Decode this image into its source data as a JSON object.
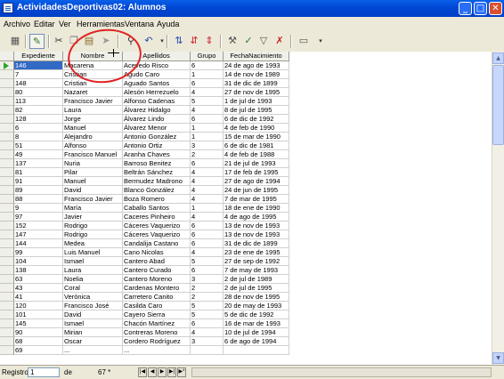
{
  "window": {
    "title": "ActividadesDeportivas02: Alumnos",
    "min": "_",
    "max": "□",
    "close": "✕"
  },
  "menu": [
    "Archivo",
    "Editar",
    "Ver",
    "Herramientas",
    "Ventana",
    "Ayuda"
  ],
  "toolbar": {
    "icons": [
      "save-icon",
      "edit-icon",
      "cut-icon",
      "copy-icon",
      "paste-icon",
      "forward-icon",
      "binoculars-icon",
      "undo-icon",
      "sort-az-icon",
      "sort-za-icon",
      "sort-icon",
      "autofilter-icon",
      "filter-apply-icon",
      "funnel-icon",
      "remove-filter-icon",
      "datasource-icon"
    ]
  },
  "grid": {
    "columns": [
      "Expediente",
      "Nombre",
      "Apellidos",
      "Grupo",
      "FechaNacimiento"
    ],
    "rows": [
      [
        "146",
        "Macarena",
        "Acevedo Risco",
        "6",
        "24 de ago de 1993"
      ],
      [
        "7",
        "Cristian",
        "Agudo Caro",
        "1",
        "14 de nov de 1989"
      ],
      [
        "148",
        "Cristian",
        "Aguado Santos",
        "6",
        "31 de dic de 1899"
      ],
      [
        "80",
        "Nazaret",
        "Alesón Herrezuelo",
        "4",
        "27 de nov de 1995"
      ],
      [
        "113",
        "Francisco Javier",
        "Alfonso Cadenas",
        "5",
        "1 de jul de 1993"
      ],
      [
        "82",
        "Laura",
        "Álvarez Hidalgo",
        "4",
        "8 de jul de 1995"
      ],
      [
        "128",
        "Jorge",
        "Álvarez Lindo",
        "6",
        "6 de dic de 1992"
      ],
      [
        "6",
        "Manuel",
        "Álvarez Menor",
        "1",
        "4 de feb de 1990"
      ],
      [
        "8",
        "Alejandro",
        "Antonio González",
        "1",
        "15 de mar de 1990"
      ],
      [
        "51",
        "Alfonso",
        "Antonio Ortiz",
        "3",
        "6 de dic de 1981"
      ],
      [
        "49",
        "Francisco Manuel",
        "Aranha Chaves",
        "2",
        "4 de feb de 1988"
      ],
      [
        "137",
        "Nuria",
        "Barroso Benitez",
        "6",
        "21 de jul de 1993"
      ],
      [
        "81",
        "Pilar",
        "Beltrán Sánchez",
        "4",
        "17 de feb de 1995"
      ],
      [
        "91",
        "Manuel",
        "Bermudez Madrono",
        "4",
        "27 de ago de 1994"
      ],
      [
        "89",
        "David",
        "Blanco González",
        "4",
        "24 de jun de 1995"
      ],
      [
        "88",
        "Francisco Javier",
        "Boza Romero",
        "4",
        "7 de mar de 1995"
      ],
      [
        "9",
        "María",
        "Caballo Santos",
        "1",
        "18 de ene de 1990"
      ],
      [
        "97",
        "Javier",
        "Caceres Pinheiro",
        "4",
        "4 de ago de 1995"
      ],
      [
        "152",
        "Rodrigo",
        "Cáceres Vaquerizo",
        "6",
        "13 de nov de 1993"
      ],
      [
        "147",
        "Rodrigo",
        "Cáceres Vaquerizo",
        "6",
        "13 de nov de 1993"
      ],
      [
        "144",
        "Medea",
        "Candalija Castano",
        "6",
        "31 de dic de 1899"
      ],
      [
        "99",
        "Luis Manuel",
        "Cano Nicolas",
        "4",
        "23 de ene de 1995"
      ],
      [
        "104",
        "Ismael",
        "Cantero Abad",
        "5",
        "27 de sep de 1992"
      ],
      [
        "138",
        "Laura",
        "Cantero Curado",
        "6",
        "7 de may de 1993"
      ],
      [
        "63",
        "Noelia",
        "Cantero Moreno",
        "3",
        "2 de jul de 1989"
      ],
      [
        "43",
        "Coral",
        "Cardenas Montero",
        "2",
        "2 de jul de 1995"
      ],
      [
        "41",
        "Verónica",
        "Carretero Canito",
        "2",
        "28 de nov de 1995"
      ],
      [
        "120",
        "Francisco José",
        "Casilda Caro",
        "5",
        "20 de may de 1993"
      ],
      [
        "101",
        "David",
        "Cayero Sierra",
        "5",
        "5 de dic de 1992"
      ],
      [
        "145",
        "Ismael",
        "Chacón Martínez",
        "6",
        "16 de mar de 1993"
      ],
      [
        "90",
        "Mirian",
        "Contreras Moreno",
        "4",
        "10 de jul de 1994"
      ],
      [
        "68",
        "Oscar",
        "Cordero Rodríguez",
        "3",
        "6 de ago de 1994"
      ],
      [
        "69",
        "...",
        "...",
        "",
        ""
      ]
    ]
  },
  "status": {
    "label": "Registro",
    "current": "1",
    "of_label": "de",
    "total": "67 *"
  },
  "colors": {
    "titlebar": "#0049d6",
    "selection": "#316ac5",
    "annotation": "#e02222"
  }
}
